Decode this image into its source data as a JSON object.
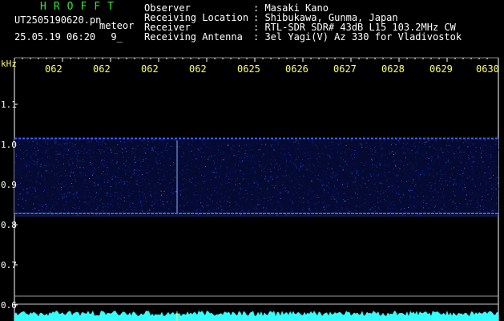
{
  "header": {
    "brand": "HROFFT",
    "filename": "UT2505190620.pn",
    "mode": "meteor",
    "datetime": "25.05.19 06:20",
    "extra": "9_"
  },
  "info": [
    {
      "label": "Observer",
      "value": ": Masaki Kano"
    },
    {
      "label": "Receiving Location",
      "value": ": Shibukawa, Gunma, Japan"
    },
    {
      "label": "Receiver",
      "value": ": RTL-SDR SDR# 43dB L15 103.2MHz CW"
    },
    {
      "label": "Receiving Antenna",
      "value": ": 3el Yagi(V) Az 330 for Vladivostok"
    }
  ],
  "axis": {
    "unit": "kHz",
    "x_ticks": [
      "062",
      "062",
      "062",
      "062",
      "0625",
      "0626",
      "0627",
      "0628",
      "0629",
      "0630"
    ],
    "y_ticks": [
      {
        "label": "1.1",
        "value": 1.1
      },
      {
        "label": "1.0",
        "value": 1.0
      },
      {
        "label": "0.9",
        "value": 0.9
      },
      {
        "label": "0.8",
        "value": 0.8
      },
      {
        "label": "0.7",
        "value": 0.7
      },
      {
        "label": "0.6",
        "value": 0.6
      }
    ]
  },
  "colors": {
    "tick_yellow": "#ffff66",
    "brand_green": "#2ee82e",
    "noise_blue": "#1a3cc8",
    "signal_cyan": "#33ffff"
  }
}
